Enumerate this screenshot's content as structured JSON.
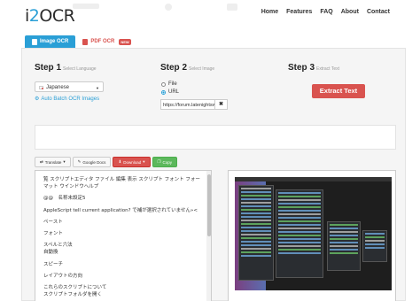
{
  "header": {
    "logo_text_prefix": "i",
    "logo_text_suffix": "OCR",
    "nav": [
      "Home",
      "Features",
      "FAQ",
      "About",
      "Contact"
    ]
  },
  "tabs": [
    {
      "label": "Image OCR",
      "active": true
    },
    {
      "label": "PDF OCR",
      "active": false,
      "badge": "NEW"
    }
  ],
  "steps": {
    "step1": {
      "title": "Step 1",
      "subtitle": "Select Language"
    },
    "step2": {
      "title": "Step 2",
      "subtitle": "Select Image"
    },
    "step3": {
      "title": "Step 3",
      "subtitle": "Extract Text"
    }
  },
  "language": {
    "selected": "Japanese"
  },
  "batch_link": "Auto Batch OCR Images",
  "source": {
    "options": [
      "File",
      "URL"
    ],
    "selected": "URL",
    "url_value": "https://forum.latenightsw.com/",
    "clear_label": "✖"
  },
  "extract_button": "Extract Text",
  "toolbar": {
    "translate": "Translate",
    "google_docs": "Google Docs",
    "download": "Download",
    "copy": "Copy"
  },
  "result_lines": [
    "覧 スクリプトエディタ ファイル 編集 表示 スクリプト フォント フォー",
    "マット ウインドウヘルプ",
    "@@　名称未設定5",
    "AppleScript tell current application? で補が選択されていません»<",
    "ペースト",
    "フォント",
    "スペルと六法",
    "自動換",
    "スピーチ",
    "レイアウトの方向",
    "これらのスクリプトについて",
    "スクリプトフォルダを開く"
  ],
  "colors": {
    "accent": "#2a9fd6",
    "danger": "#d9534f",
    "success": "#5cb85c"
  }
}
